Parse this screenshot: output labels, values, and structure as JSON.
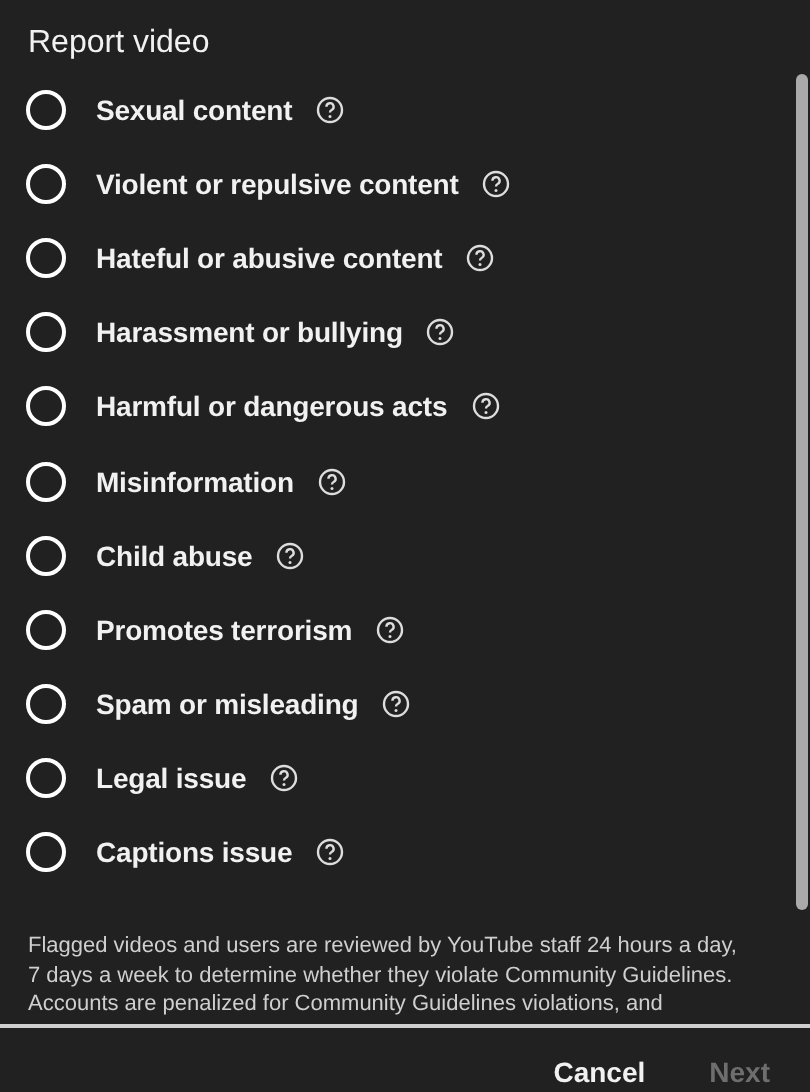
{
  "dialog": {
    "title": "Report video"
  },
  "options": [
    {
      "label": "Sexual content",
      "selected": false
    },
    {
      "label": "Violent or repulsive content",
      "selected": false
    },
    {
      "label": "Hateful or abusive content",
      "selected": false
    },
    {
      "label": "Harassment or bullying",
      "selected": false
    },
    {
      "label": "Harmful or dangerous acts",
      "selected": false
    },
    {
      "label": "Misinformation",
      "selected": false
    },
    {
      "label": "Child abuse",
      "selected": false
    },
    {
      "label": "Promotes terrorism",
      "selected": false
    },
    {
      "label": "Spam or misleading",
      "selected": false
    },
    {
      "label": "Legal issue",
      "selected": false
    },
    {
      "label": "Captions issue",
      "selected": false
    }
  ],
  "notice": "Flagged videos and users are reviewed by YouTube staff 24 hours a day, 7 days a week to determine whether they violate Community Guidelines. Accounts are penalized for Community Guidelines violations, and",
  "buttons": [
    {
      "label": "Cancel",
      "disabled": false
    },
    {
      "label": "Next",
      "disabled": true
    }
  ]
}
